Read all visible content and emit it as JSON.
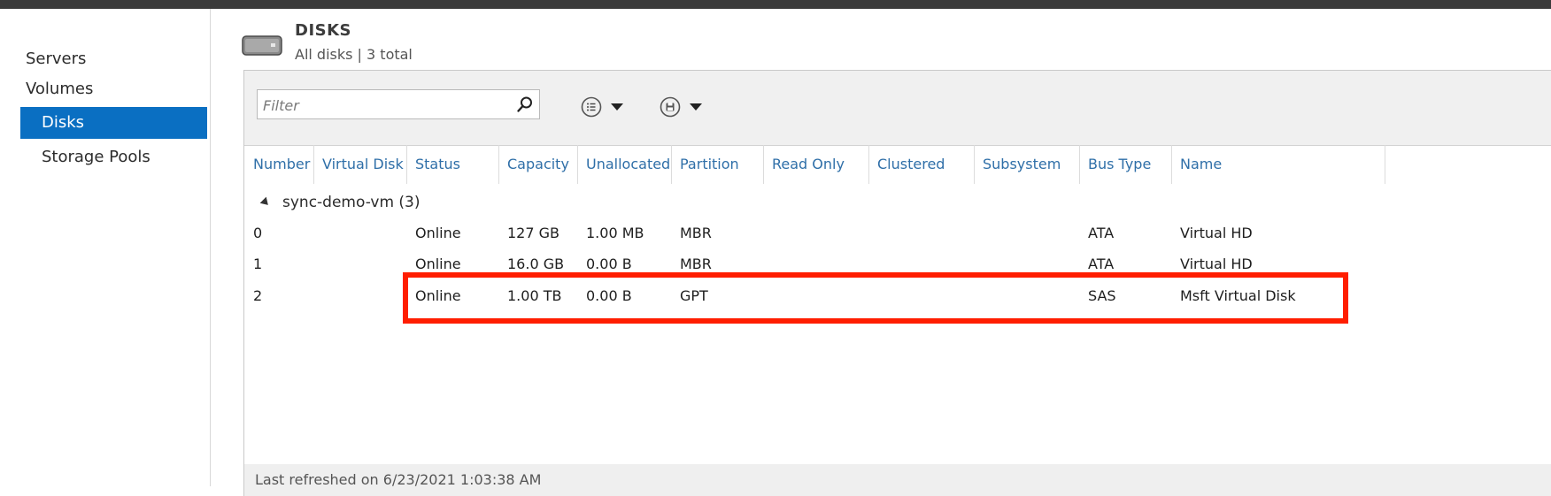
{
  "sidebar": {
    "items": [
      {
        "label": "Servers"
      },
      {
        "label": "Volumes"
      },
      {
        "label": "Disks"
      },
      {
        "label": "Storage Pools"
      }
    ]
  },
  "header": {
    "title": "DISKS",
    "subtitle": "All disks | 3 total",
    "icon": "disk-drive-icon"
  },
  "toolbar": {
    "filter_placeholder": "Filter",
    "search_icon": "search-icon",
    "view_options_icon": "list-icon",
    "save_icon": "save-icon"
  },
  "table": {
    "columns": [
      "Number",
      "Virtual Disk",
      "Status",
      "Capacity",
      "Unallocated",
      "Partition",
      "Read Only",
      "Clustered",
      "Subsystem",
      "Bus Type",
      "Name"
    ],
    "group": "sync-demo-vm (3)",
    "rows": [
      {
        "number": "0",
        "virtual_disk": "",
        "status": "Online",
        "capacity": "127 GB",
        "unallocated": "1.00 MB",
        "partition": "MBR",
        "read_only": "",
        "clustered": "",
        "subsystem": "",
        "bus_type": "ATA",
        "name": "Virtual HD"
      },
      {
        "number": "1",
        "virtual_disk": "",
        "status": "Online",
        "capacity": "16.0 GB",
        "unallocated": "0.00 B",
        "partition": "MBR",
        "read_only": "",
        "clustered": "",
        "subsystem": "",
        "bus_type": "ATA",
        "name": "Virtual HD"
      },
      {
        "number": "2",
        "virtual_disk": "",
        "status": "Online",
        "capacity": "1.00 TB",
        "unallocated": "0.00 B",
        "partition": "GPT",
        "read_only": "",
        "clustered": "",
        "subsystem": "",
        "bus_type": "SAS",
        "name": "Msft Virtual Disk"
      }
    ]
  },
  "status": {
    "last_refreshed": "Last refreshed on 6/23/2021 1:03:38 AM"
  },
  "colors": {
    "accent": "#0a6fc2",
    "highlight_box": "#ff1e00",
    "column_header": "#2f6fa8"
  }
}
